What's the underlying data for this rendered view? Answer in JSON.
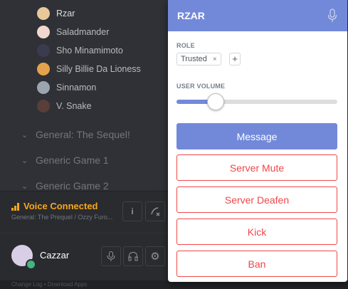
{
  "members": [
    {
      "name": "Rzar",
      "active": true,
      "avatar_color": "#e8c89a"
    },
    {
      "name": "Saladmander",
      "avatar_color": "#f2d7d0"
    },
    {
      "name": "Sho Minamimoto",
      "avatar_color": "#3b3b4f"
    },
    {
      "name": "Silly Billie Da Lioness",
      "avatar_color": "#e3a24c"
    },
    {
      "name": "Sinnamon",
      "avatar_color": "#9aa5b0"
    },
    {
      "name": "V. Snake",
      "avatar_color": "#5a3e3a"
    }
  ],
  "channels": [
    {
      "name": "General: The Sequel!"
    },
    {
      "name": "Generic Game 1"
    },
    {
      "name": "Generic Game 2"
    }
  ],
  "voice": {
    "status": "Voice Connected",
    "location": "General: The Prequel / Ozzy Furo..."
  },
  "user": {
    "name": "Cazzar"
  },
  "footer": {
    "text": "Change Log  •  Download Apps"
  },
  "popup": {
    "username": "RZAR",
    "role_label": "ROLE",
    "role_name": "Trusted",
    "role_remove": "×",
    "add_role": "+",
    "volume_label": "USER VOLUME",
    "volume_percent": 24,
    "buttons": {
      "message": "Message",
      "server_mute": "Server Mute",
      "server_deafen": "Server Deafen",
      "kick": "Kick",
      "ban": "Ban"
    }
  },
  "colors": {
    "accent": "#7289da",
    "danger": "#f04747",
    "voice": "#faa61a",
    "online": "#43b581"
  }
}
